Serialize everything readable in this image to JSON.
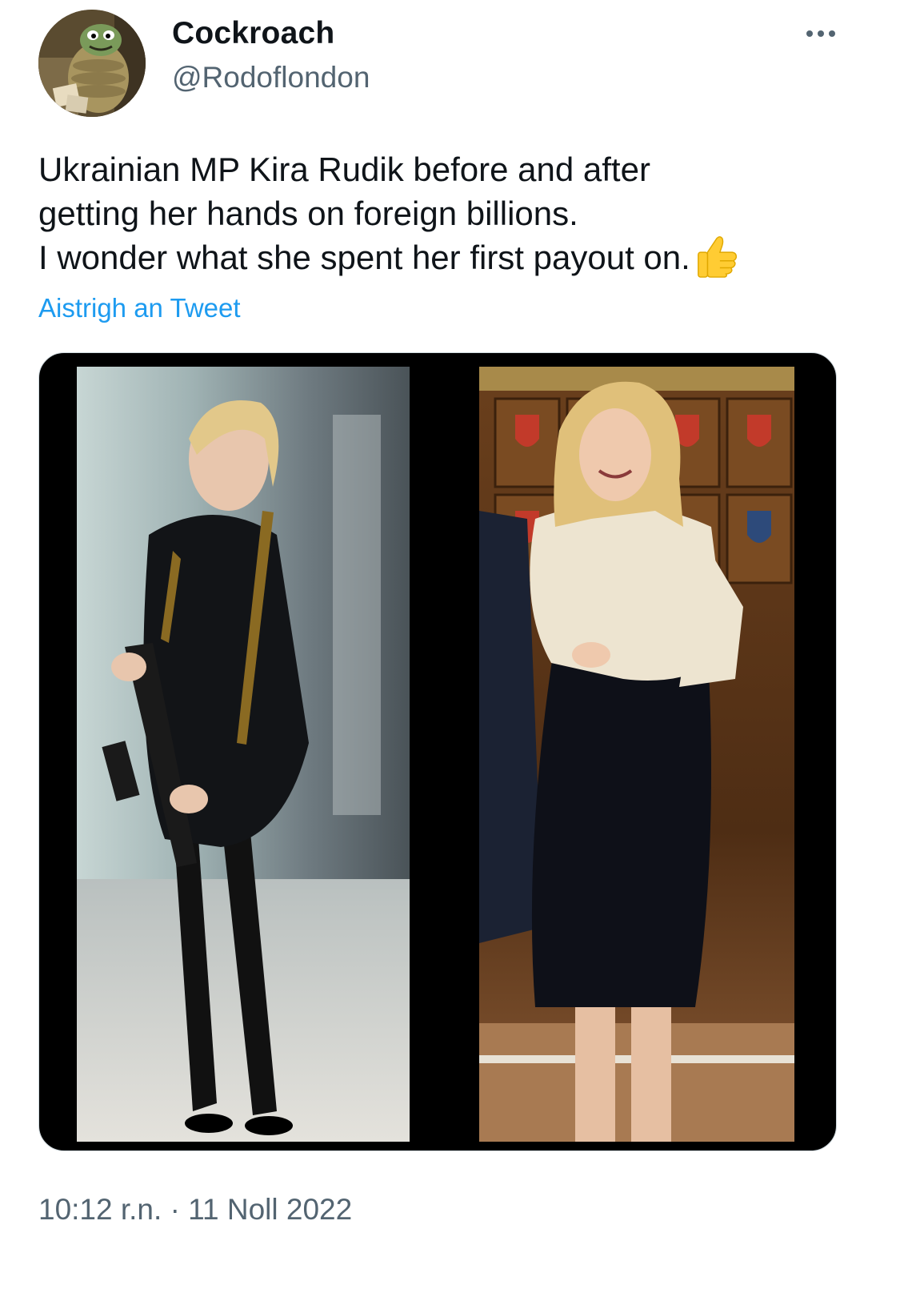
{
  "author": {
    "display_name": "Cockroach",
    "handle": "@Rodoflondon",
    "avatar_icon": "cartoon-cockroach-avatar"
  },
  "menu": {
    "icon": "more-horizontal-icon"
  },
  "tweet": {
    "lines": [
      "Ukrainian MP Kira Rudik before and after",
      "getting her hands on foreign billions.",
      "I wonder what she spent her first payout on."
    ],
    "emoji": "thumbs-up-emoji",
    "translate_label": "Aistrigh an Tweet"
  },
  "media": {
    "photos": [
      {
        "name": "before-photo"
      },
      {
        "name": "after-photo"
      }
    ]
  },
  "meta": {
    "timestamp": "10:12 r.n. · 11 Noll 2022"
  },
  "colors": {
    "link": "#1d9bf0",
    "secondary_text": "#536471",
    "primary_text": "#0f1419"
  }
}
